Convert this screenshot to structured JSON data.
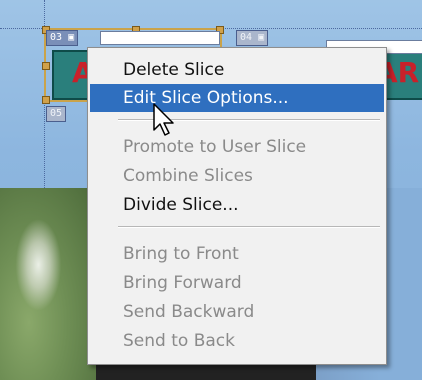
{
  "slices": {
    "badge_top_left": "03",
    "badge_top_right": "04",
    "badge_lower_left": "05",
    "banner_left_text": "A",
    "banner_right_text": "AR"
  },
  "menu": {
    "items": [
      {
        "label": "Delete Slice",
        "enabled": true
      },
      {
        "label": "Edit Slice Options...",
        "enabled": true,
        "highlighted": true
      },
      {
        "label": "Promote to User Slice",
        "enabled": false
      },
      {
        "label": "Combine Slices",
        "enabled": false
      },
      {
        "label": "Divide Slice...",
        "enabled": true
      },
      {
        "label": "Bring to Front",
        "enabled": false
      },
      {
        "label": "Bring Forward",
        "enabled": false
      },
      {
        "label": "Send Backward",
        "enabled": false
      },
      {
        "label": "Send to Back",
        "enabled": false
      }
    ]
  },
  "colors": {
    "highlight": "#2f6fbf",
    "disabled_text": "#8a8a8a",
    "menu_bg": "#f1f1f1"
  },
  "icons": [
    "pointer-cursor-icon",
    "slice-image-icon"
  ]
}
